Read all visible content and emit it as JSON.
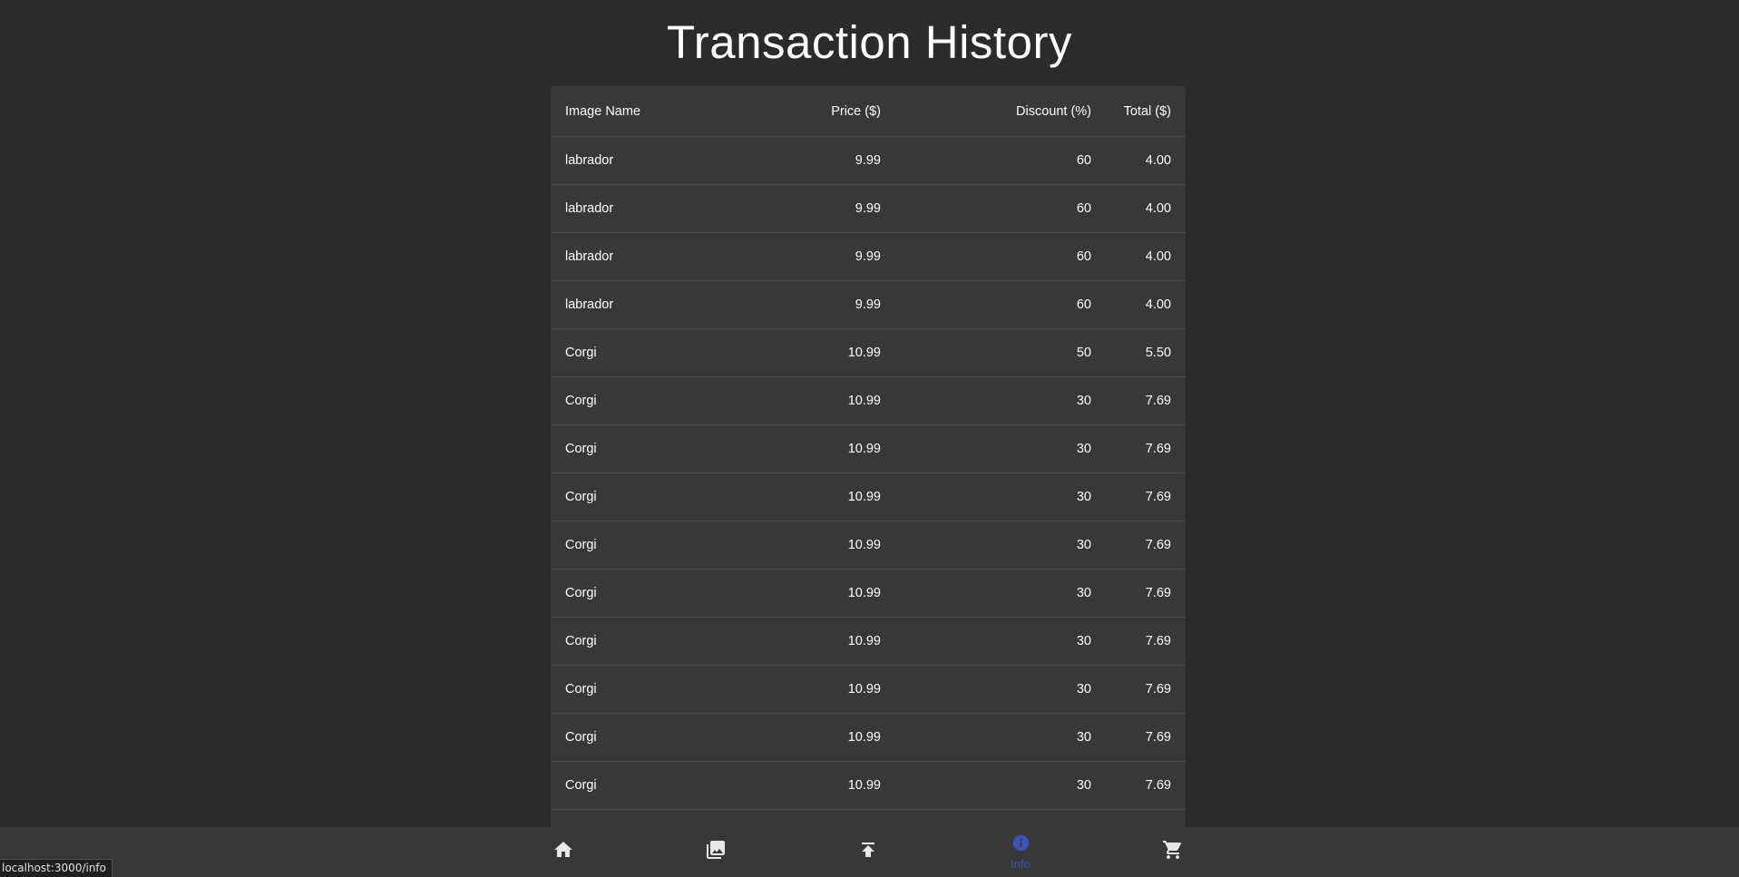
{
  "page": {
    "title": "Transaction History"
  },
  "table": {
    "headers": {
      "name": "Image Name",
      "price": "Price ($)",
      "discount": "Discount (%)",
      "total": "Total ($)"
    },
    "rows": [
      {
        "name": "labrador",
        "price": "9.99",
        "discount": "60",
        "total": "4.00"
      },
      {
        "name": "labrador",
        "price": "9.99",
        "discount": "60",
        "total": "4.00"
      },
      {
        "name": "labrador",
        "price": "9.99",
        "discount": "60",
        "total": "4.00"
      },
      {
        "name": "labrador",
        "price": "9.99",
        "discount": "60",
        "total": "4.00"
      },
      {
        "name": "Corgi",
        "price": "10.99",
        "discount": "50",
        "total": "5.50"
      },
      {
        "name": "Corgi",
        "price": "10.99",
        "discount": "30",
        "total": "7.69"
      },
      {
        "name": "Corgi",
        "price": "10.99",
        "discount": "30",
        "total": "7.69"
      },
      {
        "name": "Corgi",
        "price": "10.99",
        "discount": "30",
        "total": "7.69"
      },
      {
        "name": "Corgi",
        "price": "10.99",
        "discount": "30",
        "total": "7.69"
      },
      {
        "name": "Corgi",
        "price": "10.99",
        "discount": "30",
        "total": "7.69"
      },
      {
        "name": "Corgi",
        "price": "10.99",
        "discount": "30",
        "total": "7.69"
      },
      {
        "name": "Corgi",
        "price": "10.99",
        "discount": "30",
        "total": "7.69"
      },
      {
        "name": "Corgi",
        "price": "10.99",
        "discount": "30",
        "total": "7.69"
      },
      {
        "name": "Corgi",
        "price": "10.99",
        "discount": "30",
        "total": "7.69"
      },
      {
        "name": "",
        "price": "",
        "discount": "",
        "total": ""
      }
    ]
  },
  "nav": {
    "items": [
      {
        "icon": "home-icon",
        "label": ""
      },
      {
        "icon": "gallery-icon",
        "label": ""
      },
      {
        "icon": "upload-icon",
        "label": ""
      },
      {
        "icon": "info-icon",
        "label": "Info",
        "active": true
      },
      {
        "icon": "cart-icon",
        "label": ""
      }
    ],
    "active_color": "#3f51b5"
  },
  "status_bar": {
    "url": "localhost:3000/info"
  }
}
